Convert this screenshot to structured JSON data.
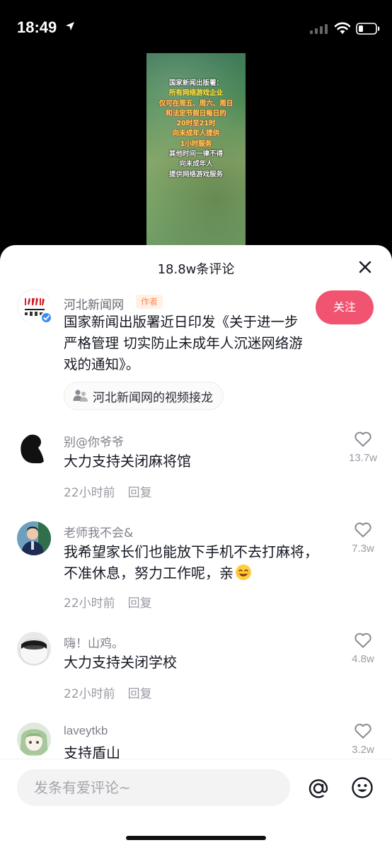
{
  "status_bar": {
    "time": "18:49"
  },
  "video": {
    "lines": [
      {
        "text": "国家新闻出版署：",
        "style": "white"
      },
      {
        "text": "所有网络游戏企业",
        "style": "yellow"
      },
      {
        "text": "仅可在周五、周六、周日",
        "style": "red"
      },
      {
        "text": "和法定节假日每日的",
        "style": "red"
      },
      {
        "text": "20时至21时",
        "style": "red"
      },
      {
        "text": "向未成年人提供",
        "style": "red"
      },
      {
        "text": "1小时服务",
        "style": "red"
      },
      {
        "text": "其他时间一律不得",
        "style": "white"
      },
      {
        "text": "向未成年人",
        "style": "white"
      },
      {
        "text": "提供网络游戏服务",
        "style": "white"
      }
    ]
  },
  "sheet": {
    "title": "18.8w条评论",
    "author": {
      "name": "河北新闻网",
      "tag": "作者",
      "follow_label": "关注",
      "text": "国家新闻出版署近日印发《关于进一步严格管理 切实防止未成年人沉迷网络游戏的通知》。",
      "chain_label": "河北新闻网的视频接龙"
    },
    "comments": [
      {
        "user": "别@你爷爷",
        "text": "大力支持关闭麻将馆",
        "time": "22小时前",
        "reply": "回复",
        "likes": "13.7w"
      },
      {
        "user": "老师我不会&",
        "text": "我希望家长们也能放下手机不去打麻将，不准休息，努力工作呢，亲",
        "time": "22小时前",
        "reply": "回复",
        "likes": "7.3w"
      },
      {
        "user": "嗨！山鸡。",
        "text": "大力支持关闭学校",
        "time": "22小时前",
        "reply": "回复",
        "likes": "4.8w"
      },
      {
        "user": "laveytkb",
        "text": "支持盾山",
        "likes": "3.2w"
      }
    ]
  },
  "input": {
    "placeholder": "发条有爱评论~"
  },
  "colors": {
    "follow": "#f05470",
    "author_tag_bg": "#fff1e8",
    "author_tag_text": "#fe8a4c"
  }
}
